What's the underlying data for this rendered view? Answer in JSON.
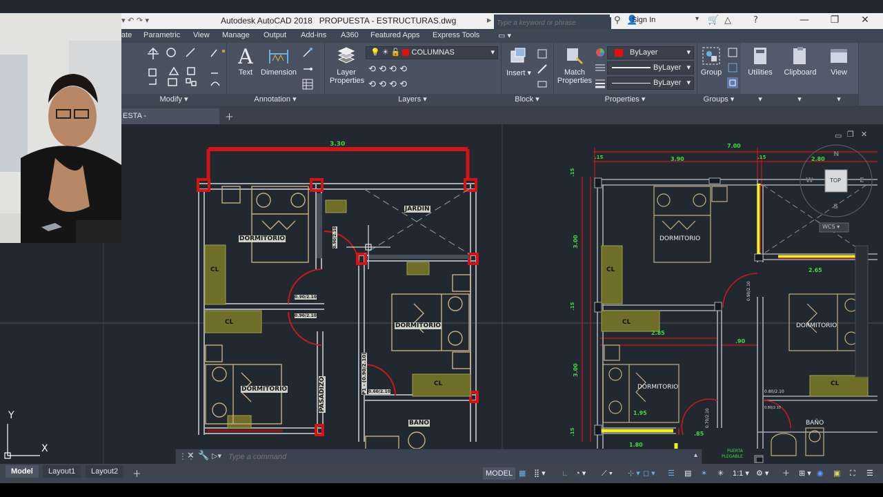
{
  "app": {
    "title": "Autodesk AutoCAD 2018",
    "document": "PROPUESTA - ESTRUCTURAS.dwg",
    "search_placeholder": "Type a keyword or phrase",
    "sign_in": "Sign In"
  },
  "ribbon_tabs": [
    "ate",
    "Parametric",
    "View",
    "Manage",
    "Output",
    "Add-ins",
    "A360",
    "Featured Apps",
    "Express Tools"
  ],
  "panels": {
    "modify": "Modify",
    "annotation": "Annotation",
    "layers": "Layers",
    "block": "Block",
    "properties": "Properties",
    "groups": "Groups"
  },
  "buttons": {
    "text": "Text",
    "dimension": "Dimension",
    "layer_properties_1": "Layer",
    "layer_properties_2": "Properties",
    "insert": "Insert",
    "match_1": "Match",
    "match_2": "Properties",
    "group": "Group",
    "utilities": "Utilities",
    "clipboard": "Clipboard",
    "view": "View"
  },
  "layer_current": "COLUMNAS",
  "props": {
    "color": "ByLayer",
    "linetype": "ByLayer",
    "lineweight": "ByLayer"
  },
  "doc_tab": "ESTA - ESTRUCTURAS*",
  "command_placeholder": "Type a command",
  "layout_tabs": {
    "model": "Model",
    "layout1": "Layout1",
    "layout2": "Layout2"
  },
  "status": {
    "model": "MODEL",
    "scale": "1:1"
  },
  "viewcube": {
    "top": "TOP",
    "n": "N",
    "s": "S",
    "w": "W",
    "e": "E",
    "wcs": "WCS"
  },
  "axis": {
    "x": "X",
    "y": "Y"
  },
  "left_plan": {
    "top_dim": "3.30",
    "rooms": [
      "DORMITORIO",
      "JARDÍN",
      "DORMITORIO",
      "DORMITORIO",
      "BAÑO",
      "PASADIZO"
    ],
    "closets": [
      "CL",
      "CL",
      "CL"
    ],
    "door_labels": [
      "0.90/2.10",
      "0.90/2.10",
      "0.90/2.10",
      "0.60/2.10",
      "P1 - (0.90/2.10)"
    ]
  },
  "right_plan": {
    "dims": [
      "7.00",
      "3.90",
      "2.80",
      ".15",
      ".15",
      ".15",
      "3.00",
      "2.65",
      "2.85",
      ".90",
      "3.00",
      "1.95",
      "1.80",
      ".85",
      ".15",
      ".15"
    ],
    "rooms": [
      "DORMITORIO",
      "DORMITORIO",
      "DORMITORIO",
      "BAÑO"
    ],
    "closets": [
      "CL",
      "CL",
      "CL"
    ],
    "door_labels": [
      "0.90/2.10",
      "0.80/2.10",
      "0.80/2.10",
      "0.70/2.10"
    ],
    "misc": [
      "PUERTA",
      "PLEGABLE"
    ]
  },
  "colors": {
    "wall_red": "#d41414",
    "dim_green": "#3ddc3d",
    "furniture_tan": "#c9b07e",
    "closet_olive": "#7a7a2a",
    "highlight_yellow": "#f0f020",
    "wall_gray": "#a8aab0"
  }
}
